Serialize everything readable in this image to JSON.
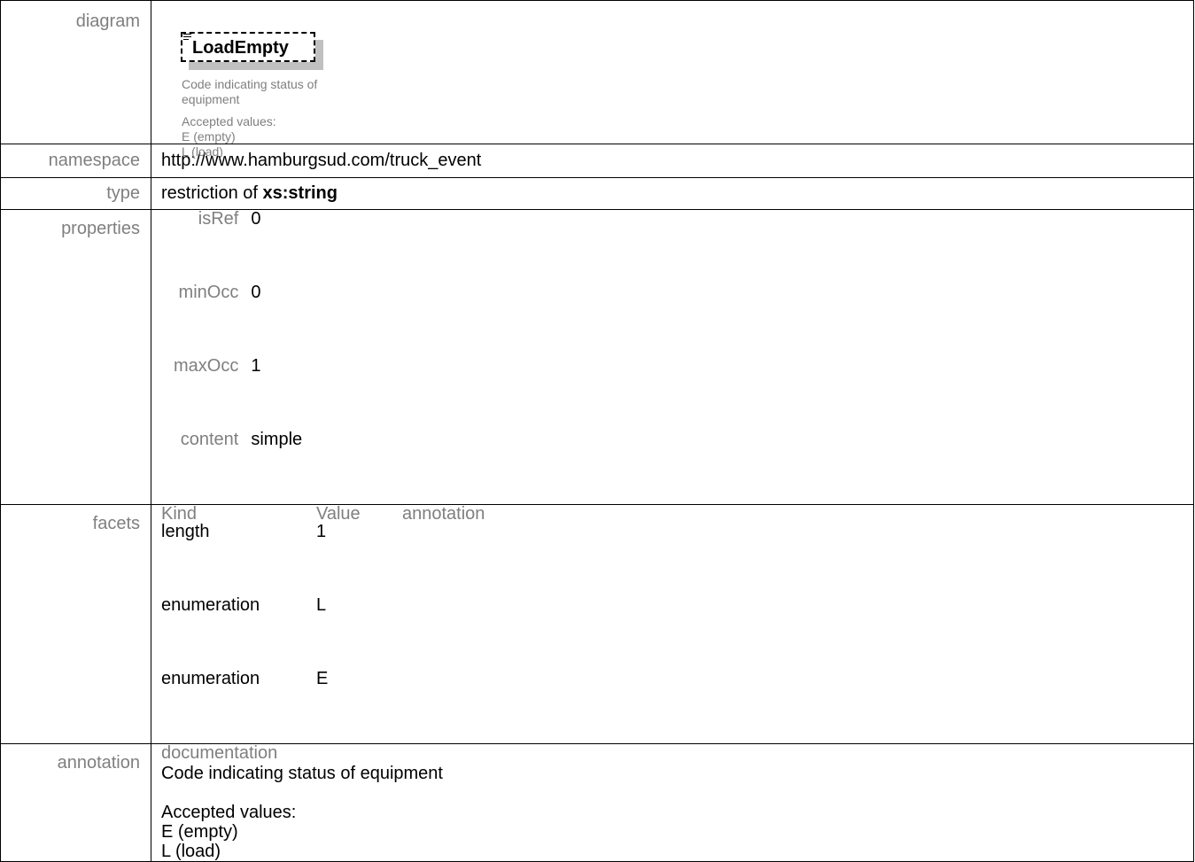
{
  "labels": {
    "diagram": "diagram",
    "namespace": "namespace",
    "type": "type",
    "properties": "properties",
    "facets": "facets",
    "annotation": "annotation"
  },
  "diagram": {
    "element_name": "LoadEmpty",
    "desc": "Code indicating status of\nequipment",
    "values_text": "Accepted values:\nE  (empty)\nL   (load)"
  },
  "namespace": "http://www.hamburgsud.com/truck_event",
  "type": {
    "prefix": "restriction of",
    "base": "xs:string"
  },
  "properties": [
    {
      "key": "isRef",
      "value": "0"
    },
    {
      "key": "minOcc",
      "value": "0"
    },
    {
      "key": "maxOcc",
      "value": "1"
    },
    {
      "key": "content",
      "value": "simple"
    }
  ],
  "facets": {
    "headers": [
      "Kind",
      "Value",
      "annotation"
    ],
    "rows": [
      {
        "kind": "length",
        "value": "1",
        "annotation": ""
      },
      {
        "kind": "enumeration",
        "value": "L",
        "annotation": ""
      },
      {
        "kind": "enumeration",
        "value": "E",
        "annotation": ""
      }
    ]
  },
  "annotation": {
    "heading": "documentation",
    "text": "Code indicating status of equipment\n\nAccepted values:\nE  (empty)\nL   (load)"
  }
}
